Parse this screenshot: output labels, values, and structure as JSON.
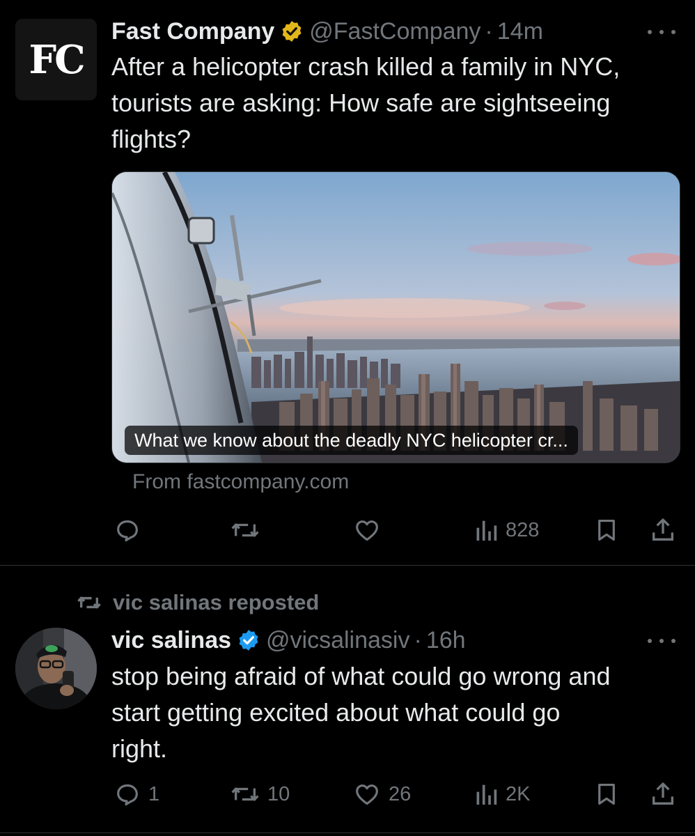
{
  "tweets": [
    {
      "display_name": "Fast Company",
      "avatar_text": "FC",
      "handle": "@FastCompany",
      "separator": "·",
      "time": "14m",
      "text": "After a helicopter crash killed a family in NYC,\ntourists are asking: How safe are sightseeing\nflights?",
      "card": {
        "caption": "What we know about the deadly NYC helicopter cr...",
        "source": "From fastcompany.com"
      },
      "metrics": {
        "replies": "",
        "reposts": "",
        "likes": "",
        "views": "828"
      },
      "verified_color": "#e2b719"
    },
    {
      "repost_label": "vic salinas reposted",
      "display_name": "vic salinas",
      "handle": "@vicsalinasiv",
      "separator": "·",
      "time": "16h",
      "text": "stop being afraid of what could go wrong and\nstart getting excited about what could go\nright.",
      "metrics": {
        "replies": "1",
        "reposts": "10",
        "likes": "26",
        "views": "2K"
      },
      "verified_color": "#1d9bf0"
    }
  ],
  "icons": {
    "reply": "reply-icon",
    "repost": "repost-icon",
    "like": "heart-icon",
    "views": "views-icon",
    "bookmark": "bookmark-icon",
    "share": "share-icon",
    "more": "more-icon",
    "verified": "verified-badge-icon"
  },
  "colors": {
    "background": "#000000",
    "text": "#e7e9ea",
    "muted": "#71767b",
    "divider": "#2f3336"
  }
}
